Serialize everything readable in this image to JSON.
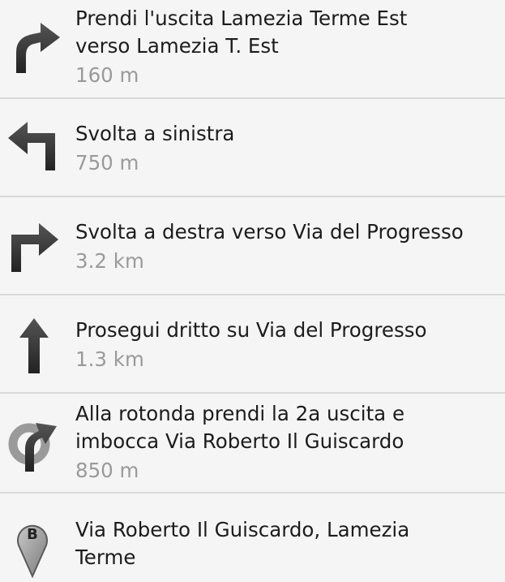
{
  "directions": [
    {
      "icon": "slight-right-arrow-icon",
      "instruction": "Prendi l'uscita Lamezia Terme Est\nverso Lamezia T. Est",
      "distance": "160 m"
    },
    {
      "icon": "turn-left-arrow-icon",
      "instruction": "Svolta a sinistra",
      "distance": "750 m"
    },
    {
      "icon": "turn-right-arrow-icon",
      "instruction": "Svolta a destra verso Via del Progresso",
      "distance": "3.2 km"
    },
    {
      "icon": "straight-arrow-icon",
      "instruction": "Prosegui dritto su Via del Progresso",
      "distance": "1.3 km"
    },
    {
      "icon": "roundabout-icon",
      "instruction": "Alla rotonda prendi la 2a uscita e\nimbocca Via Roberto Il Guiscardo",
      "distance": "850 m"
    },
    {
      "icon": "destination-marker-icon",
      "marker_letter": "B",
      "instruction": "Via Roberto Il Guiscardo, Lamezia\nTerme"
    }
  ]
}
